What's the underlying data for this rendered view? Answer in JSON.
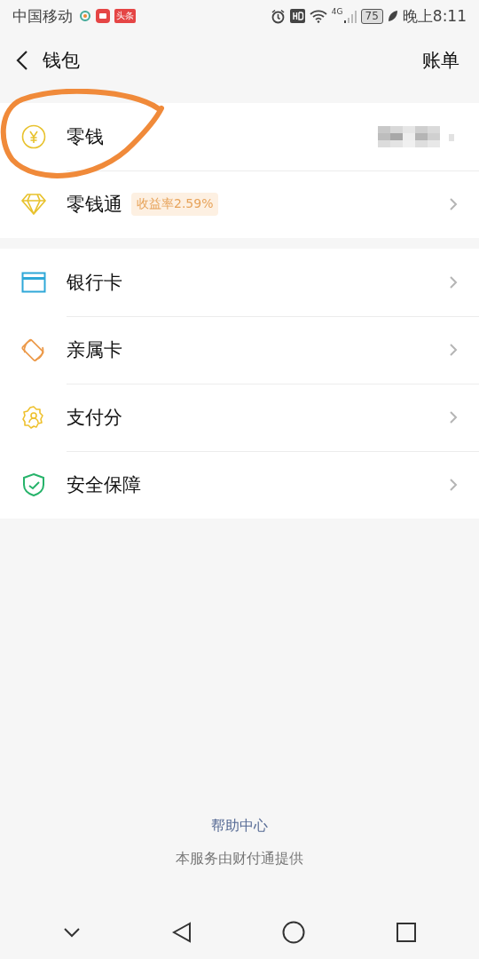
{
  "status_bar": {
    "carrier": "中国移动",
    "app_badge": "头条",
    "network": "4G",
    "battery": "75",
    "time": "晚上8:11"
  },
  "header": {
    "title": "钱包",
    "action": "账单"
  },
  "groups": [
    {
      "items": [
        {
          "kind": "coin",
          "label": "零钱",
          "redacted": true,
          "chevron": false,
          "annotated": true
        },
        {
          "kind": "diamond",
          "label": "零钱通",
          "tag": "收益率2.59%",
          "redacted": false,
          "chevron": true,
          "annotated": false
        }
      ]
    },
    {
      "items": [
        {
          "kind": "card",
          "label": "银行卡",
          "redacted": false,
          "chevron": true,
          "annotated": false
        },
        {
          "kind": "family-card",
          "label": "亲属卡",
          "redacted": false,
          "chevron": true,
          "annotated": false
        },
        {
          "kind": "score",
          "label": "支付分",
          "redacted": false,
          "chevron": true,
          "annotated": false
        },
        {
          "kind": "shield",
          "label": "安全保障",
          "redacted": false,
          "chevron": true,
          "annotated": false
        }
      ]
    }
  ],
  "footer": {
    "link": "帮助中心",
    "note": "本服务由财付通提供"
  }
}
